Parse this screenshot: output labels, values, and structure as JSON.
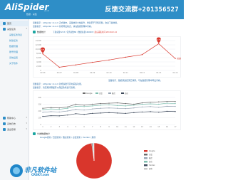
{
  "header": {
    "brand": "AliSpider",
    "brand_sub": "数据 · 采集",
    "version": "v1.0",
    "qq_banner": "反馈交流群+201356527"
  },
  "sidebar": {
    "items": [
      {
        "label": "首页"
      },
      {
        "label": "采集任务"
      },
      {
        "label": "采集任务列表"
      },
      {
        "label": "新建任务"
      },
      {
        "label": "数据管理"
      },
      {
        "label": "账号管理"
      },
      {
        "label": "系统设置"
      },
      {
        "label": "关于软件"
      },
      {
        "label": "帮助中心"
      },
      {
        "label": "系统日志"
      },
      {
        "label": "退出登录"
      }
    ]
  },
  "notices": [
    "温馨提示：AliSpider v1.4.0 正式发布，采集效率大幅提升，修复若干已知问题，欢迎下载体验。",
    "温馨提示：AliSpider v1.4.0 新增导出格式，请在数据管理中查看。"
  ],
  "panel1": {
    "title": "数据统计",
    "info_prefix": "下载总量5213 / 任务总数86 / 数据总量162048 /",
    "info_red": "最后采集时间 2018-02-14"
  },
  "notice_mid": "温馨提示：数据采集结果已保存，可在数据管理中导出查看。",
  "notices2": [
    "温馨提示：AliSpider v1.4.0 新增多账号同时采集功能。",
    "温馨提示：请定期清理缓存以保证软件运行流畅。"
  ],
  "panel2": {
    "title": "分类数据统计",
    "info": "Google搜索 / 百度搜索 / 雅虎搜索 / 必应搜索 / Yandex / 其他"
  },
  "chart_data": [
    {
      "type": "line",
      "categories": [
        "02-06",
        "02-07",
        "02-08",
        "02-09",
        "02-10",
        "02-11",
        "02-12",
        "02-13",
        "02-14"
      ],
      "series": [
        {
          "name": "采集数量",
          "color": "#d9362c",
          "values": [
            7800,
            1500,
            2600,
            3800,
            4900,
            6200,
            7400,
            12500,
            5600
          ]
        }
      ],
      "ylim": [
        0,
        14000
      ],
      "yticks": [
        "14,000",
        "12,000",
        "10,000",
        "8,000",
        "6,000",
        "4,000",
        "2,000",
        "0"
      ],
      "markers": [
        {
          "index": 0,
          "label": "7.8K"
        },
        {
          "index": 7,
          "label": "12.5K"
        }
      ],
      "grid": true
    },
    {
      "type": "line",
      "categories": [
        "1",
        "2",
        "3",
        "4",
        "5",
        "6",
        "7",
        "8",
        "9",
        "10",
        "11",
        "12",
        "13",
        "14",
        "15",
        "16",
        "17"
      ],
      "series": [
        {
          "name": "Google",
          "color": "#6b6b6b",
          "values": [
            240,
            250,
            245,
            260,
            300,
            285,
            300,
            310,
            315,
            320,
            310,
            300,
            320,
            330,
            335,
            340,
            340
          ]
        },
        {
          "name": "百度",
          "color": "#7fbfb0",
          "values": [
            220,
            230,
            225,
            240,
            270,
            265,
            275,
            285,
            290,
            280,
            275,
            285,
            300,
            305,
            300,
            315,
            310
          ]
        },
        {
          "name": "雅虎",
          "color": "#9aa7b6",
          "values": [
            180,
            190,
            185,
            200,
            225,
            215,
            230,
            240,
            245,
            240,
            235,
            245,
            260,
            265,
            255,
            270,
            268
          ]
        },
        {
          "name": "必应",
          "color": "#3e4a5c",
          "values": [
            120,
            130,
            128,
            140,
            160,
            150,
            165,
            170,
            175,
            170,
            165,
            175,
            185,
            190,
            182,
            195,
            192
          ]
        }
      ],
      "ylim": [
        0,
        400
      ],
      "yticks": [
        "400",
        "300",
        "200",
        "100",
        "0"
      ],
      "legend": "top-center",
      "grid": true
    },
    {
      "type": "pie",
      "categories": [
        "Google",
        "百度",
        "雅虎",
        "必应",
        "Yandex",
        "其他"
      ],
      "values": [
        97.8,
        0.8,
        0.5,
        0.4,
        0.3,
        0.2
      ],
      "colors": [
        "#d9362c",
        "#6b6b6b",
        "#9aa7b6",
        "#7fbfb0",
        "#3e4a5c",
        "#c9c9c9"
      ],
      "legend": "right"
    }
  ],
  "watermark": {
    "title": "非凡软件站",
    "url": "CRSKY.com"
  }
}
